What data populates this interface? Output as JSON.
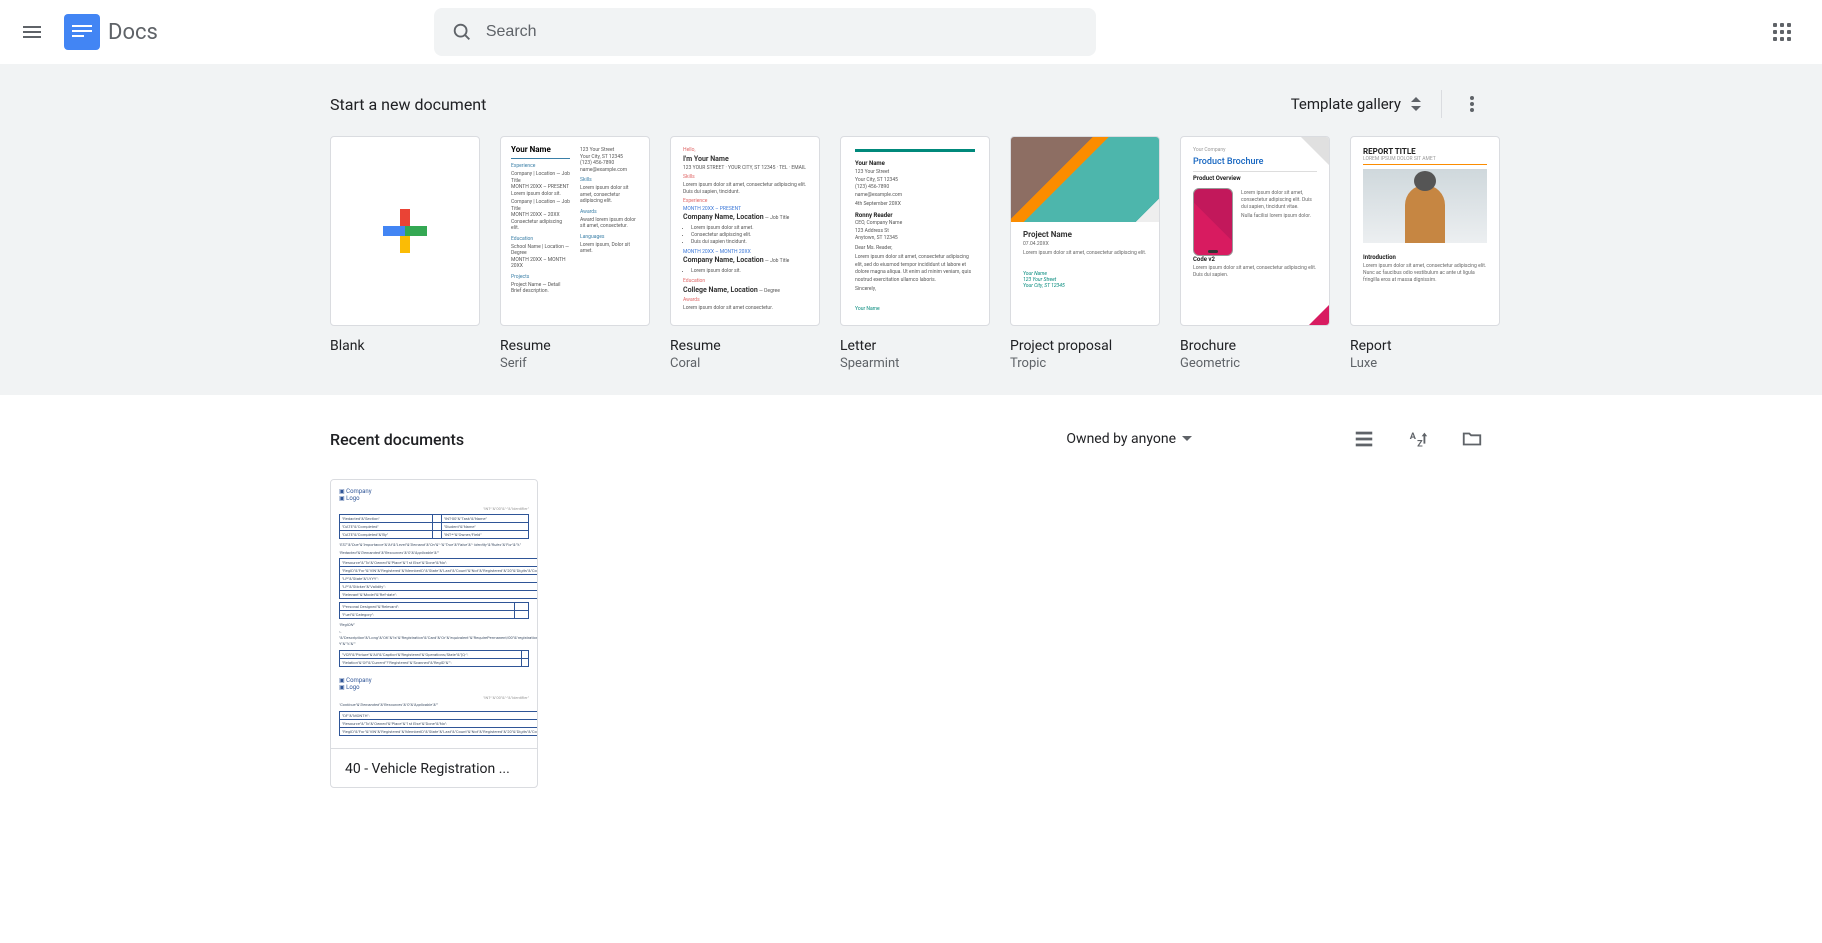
{
  "header": {
    "app_title": "Docs",
    "search_placeholder": "Search"
  },
  "start": {
    "title": "Start a new document",
    "gallery_label": "Template gallery",
    "templates": [
      {
        "title": "Blank",
        "sub": ""
      },
      {
        "title": "Resume",
        "sub": "Serif"
      },
      {
        "title": "Resume",
        "sub": "Coral"
      },
      {
        "title": "Letter",
        "sub": "Spearmint"
      },
      {
        "title": "Project proposal",
        "sub": "Tropic"
      },
      {
        "title": "Brochure",
        "sub": "Geometric"
      },
      {
        "title": "Report",
        "sub": "Luxe"
      }
    ]
  },
  "recent": {
    "title": "Recent documents",
    "owned_label": "Owned by anyone",
    "documents": [
      {
        "name": "40 - Vehicle Registration ..."
      }
    ]
  }
}
